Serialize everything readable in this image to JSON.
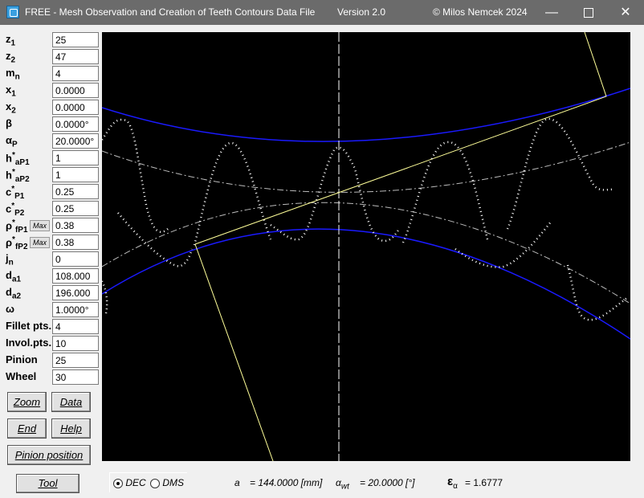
{
  "window": {
    "title": "FREE - Mesh Observation and Creation of Teeth Contours Data File",
    "version": "Version  2.0",
    "copyright": "© Milos Nemcek  2024",
    "min_glyph": "—",
    "close_glyph": "✕"
  },
  "params": [
    {
      "sym": "z",
      "sub": "1",
      "value": "25"
    },
    {
      "sym": "z",
      "sub": "2",
      "value": "47"
    },
    {
      "sym": "m",
      "sub": "n",
      "value": "4"
    },
    {
      "sym": "x",
      "sub": "1",
      "value": "0.0000"
    },
    {
      "sym": "x",
      "sub": "2",
      "value": "0.0000"
    },
    {
      "sym": "β",
      "sub": "",
      "value": "0.0000°"
    },
    {
      "sym": "α",
      "sub": "P",
      "value": "20.0000°"
    },
    {
      "sym": "h",
      "sup": "*",
      "sub": "aP1",
      "value": "1"
    },
    {
      "sym": "h",
      "sup": "*",
      "sub": "aP2",
      "value": "1"
    },
    {
      "sym": "c",
      "sup": "*",
      "sub": "P1",
      "value": "0.25"
    },
    {
      "sym": "c",
      "sup": "*",
      "sub": "P2",
      "value": "0.25"
    },
    {
      "sym": "ρ",
      "sup": "*",
      "sub": "fP1",
      "value": "0.38"
    },
    {
      "sym": "ρ",
      "sup": "*",
      "sub": "fP2",
      "value": "0.38"
    },
    {
      "sym": "j",
      "sub": "n",
      "value": "0"
    },
    {
      "sym": "d",
      "sub": "a1",
      "value": "108.000"
    },
    {
      "sym": "d",
      "sub": "a2",
      "value": "196.000"
    },
    {
      "sym": "ω",
      "sub": "",
      "value": "1.0000°"
    },
    {
      "sym": "Fillet pts.",
      "sub": "",
      "value": "4"
    },
    {
      "sym": "Invol.pts.",
      "sub": "",
      "value": "10"
    },
    {
      "sym": "Pinion",
      "sub": "",
      "value": "25"
    },
    {
      "sym": "Wheel",
      "sub": "",
      "value": "30"
    }
  ],
  "max_button_label": "Max",
  "buttons": {
    "zoom": "Zoom",
    "data": "Data",
    "end": "End",
    "help": "Help",
    "pinion_position": "Pinion position",
    "tool": "Tool"
  },
  "format": {
    "dec": "DEC",
    "dms": "DMS",
    "selected": "DEC"
  },
  "results": {
    "a_label": "a",
    "a_value": "= 144.0000 [mm]",
    "alpha_label": "α",
    "alpha_sub": "wt",
    "alpha_value": "= 20.0000 [°]",
    "eps_label": "ε",
    "eps_sub": "α",
    "eps_value": "= 1.6777"
  },
  "colors": {
    "canvas": "#000000",
    "tip_circle": "#1a1aff",
    "action_line": "#ffff99",
    "tooth": "#ffffff",
    "titlebar": "#6b6b6b"
  }
}
